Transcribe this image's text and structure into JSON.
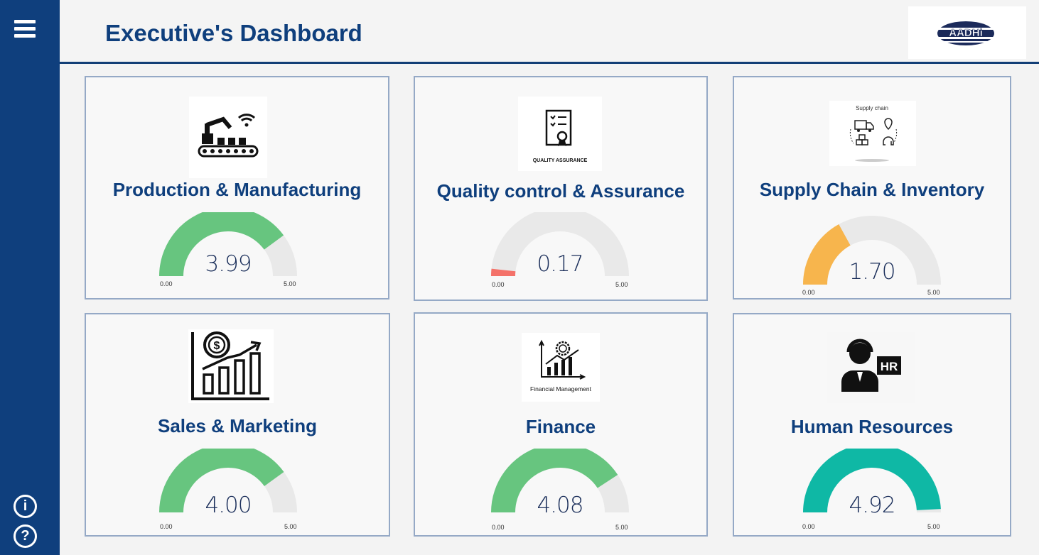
{
  "header": {
    "title": "Executive's Dashboard",
    "logo_text": "AADHi"
  },
  "cards": [
    {
      "title": "Production & Manufacturing",
      "value": "3.99",
      "numeric": 3.99,
      "min": "0.00",
      "max": "5.00",
      "color": "#67c57f",
      "icon": "factory-robot-icon"
    },
    {
      "title": "Quality control & Assurance",
      "value": "0.17",
      "numeric": 0.17,
      "min": "0.00",
      "max": "5.00",
      "color": "#f4726a",
      "icon": "certificate-icon",
      "icon_caption": "QUALITY ASSURANCE"
    },
    {
      "title": "Supply Chain & Inventory",
      "value": "1.70",
      "numeric": 1.7,
      "min": "0.00",
      "max": "5.00",
      "color": "#f7b54d",
      "icon": "supply-chain-icon",
      "icon_caption": "Supply chain"
    },
    {
      "title": "Sales & Marketing",
      "value": "4.00",
      "numeric": 4.0,
      "min": "0.00",
      "max": "5.00",
      "color": "#67c57f",
      "icon": "sales-growth-icon"
    },
    {
      "title": "Finance",
      "value": "4.08",
      "numeric": 4.08,
      "min": "0.00",
      "max": "5.00",
      "color": "#67c57f",
      "icon": "financial-management-icon",
      "icon_caption": "Financial Management"
    },
    {
      "title": "Human Resources",
      "value": "4.92",
      "numeric": 4.92,
      "min": "0.00",
      "max": "5.00",
      "color": "#0fb8a5",
      "icon": "hr-person-icon",
      "icon_caption": "HR"
    }
  ],
  "sidebar": {
    "info_label": "i",
    "help_label": "?"
  }
}
